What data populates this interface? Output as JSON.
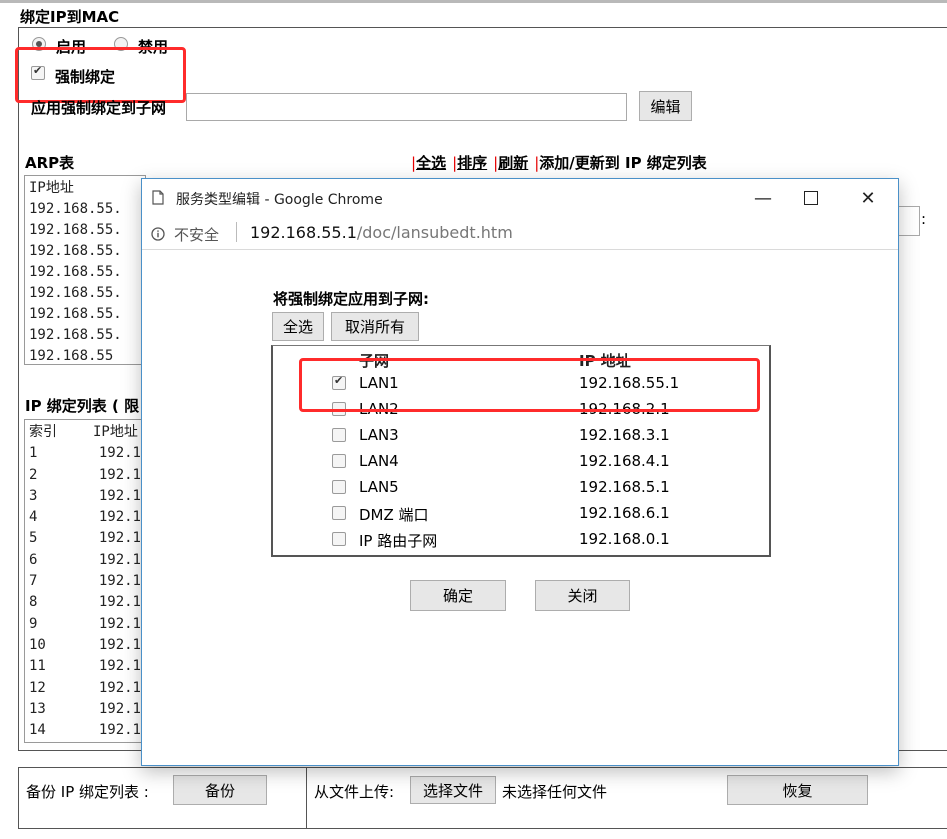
{
  "section": {
    "title": "绑定IP到MAC",
    "enable_label": "启用",
    "disable_label": "禁用",
    "force_bind_label": "强制绑定",
    "apply_subnet_label": "应用强制绑定到子网",
    "edit_button": "编辑"
  },
  "arp": {
    "title": "ARP表",
    "select_all": "全选",
    "sort": "排序",
    "refresh": "刷新",
    "add_update": "添加/更新到 IP 绑定列表",
    "column": "IP地址",
    "rows": [
      "192.168.55.",
      "192.168.55.",
      "192.168.55.",
      "192.168.55.",
      "192.168.55.",
      "192.168.55.",
      "192.168.55.",
      "192.168.55"
    ],
    "colon": ":"
  },
  "ip_bind": {
    "title": "IP 绑定列表 ( 限",
    "col_index": "索引",
    "col_ip": "IP地址",
    "rows": [
      {
        "index": "1",
        "ip": "192.1"
      },
      {
        "index": "2",
        "ip": "192.1"
      },
      {
        "index": "3",
        "ip": "192.1"
      },
      {
        "index": "4",
        "ip": "192.1"
      },
      {
        "index": "5",
        "ip": "192.1"
      },
      {
        "index": "6",
        "ip": "192.1"
      },
      {
        "index": "7",
        "ip": "192.1"
      },
      {
        "index": "8",
        "ip": "192.1"
      },
      {
        "index": "9",
        "ip": "192.1"
      },
      {
        "index": "10",
        "ip": "192.1"
      },
      {
        "index": "11",
        "ip": "192.1"
      },
      {
        "index": "12",
        "ip": "192.1"
      },
      {
        "index": "13",
        "ip": "192.1"
      },
      {
        "index": "14",
        "ip": "192.1"
      }
    ]
  },
  "bottom": {
    "backup_label": "备份 IP 绑定列表 :",
    "backup_button": "备份",
    "upload_label": "从文件上传:",
    "choose_file": "选择文件",
    "no_file": "未选择任何文件",
    "restore_button": "恢复"
  },
  "popup": {
    "window_title": "服务类型编辑 - Google Chrome",
    "insecure": "不安全",
    "url_host": "192.168.55.1",
    "url_path": "/doc/lansubedt.htm",
    "heading": "将强制绑定应用到子网:",
    "select_all": "全选",
    "deselect_all": "取消所有",
    "col_subnet": "子网",
    "col_ip": "IP 地址",
    "subnets": [
      {
        "name": "LAN1",
        "ip": "192.168.55.1",
        "checked": true
      },
      {
        "name": "LAN2",
        "ip": "192.168.2.1",
        "checked": false
      },
      {
        "name": "LAN3",
        "ip": "192.168.3.1",
        "checked": false
      },
      {
        "name": "LAN4",
        "ip": "192.168.4.1",
        "checked": false
      },
      {
        "name": "LAN5",
        "ip": "192.168.5.1",
        "checked": false
      },
      {
        "name": "DMZ 端口",
        "ip": "192.168.6.1",
        "checked": false
      },
      {
        "name": "IP 路由子网",
        "ip": "192.168.0.1",
        "checked": false
      }
    ],
    "ok_button": "确定",
    "close_button": "关闭"
  },
  "colors": {
    "highlight": "#ff2b2b",
    "separator": "#e60000",
    "window_border": "#4a90c8"
  }
}
